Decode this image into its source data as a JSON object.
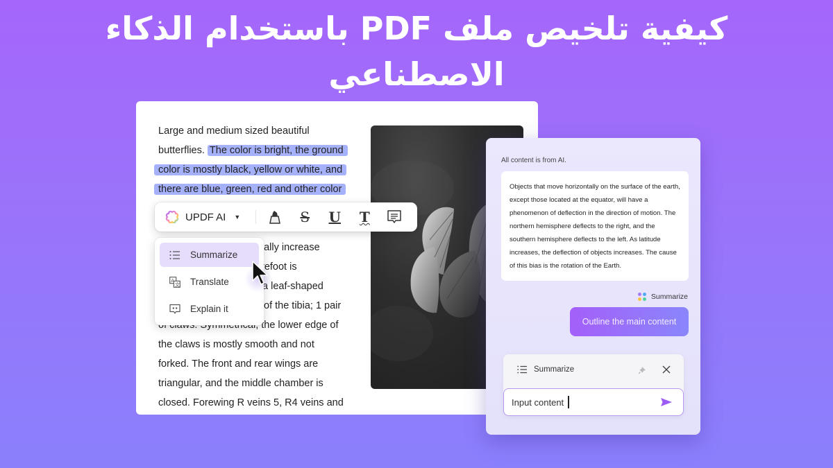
{
  "title": "كيفية تلخيص ملف PDF باستخدام الذكاء الاصطناعي",
  "document": {
    "lines": [
      {
        "plain": "Large and medium sized beautiful",
        "highlighted": ""
      },
      {
        "plain": "butterflies. ",
        "highlighted": "The color is bright, the ground"
      },
      {
        "plain": "",
        "highlighted": "color is mostly black, yellow or white, and"
      },
      {
        "plain": "",
        "highlighted": "there are blue, green, red and other color"
      },
      {
        "plain": "ually increase",
        "highlighted": ""
      },
      {
        "plain": "refoot is",
        "highlighted": ""
      },
      {
        "plain": "a leaf-shaped",
        "highlighted": ""
      },
      {
        "plain": "of the tibia; 1 pair",
        "highlighted": ""
      },
      {
        "plain": "of claws. Symmetrical, the lower edge of",
        "highlighted": ""
      },
      {
        "plain": "the claws is mostly smooth and not",
        "highlighted": ""
      },
      {
        "plain": "forked. The front and rear wings are",
        "highlighted": ""
      },
      {
        "plain": "triangular, and the middle chamber is",
        "highlighted": ""
      },
      {
        "plain": "closed. Forewing R veins 5, R4 veins and",
        "highlighted": ""
      }
    ],
    "highlight_color": "#a6b1fb",
    "image": "butterfly-photo"
  },
  "toolbar": {
    "ai_label": "UPDF AI",
    "tools": [
      "highlight-icon",
      "strikethrough-icon",
      "underline-icon",
      "squiggly-text-icon",
      "comment-icon"
    ]
  },
  "menu": {
    "items": [
      {
        "label": "Summarize",
        "icon": "list-icon",
        "active": true
      },
      {
        "label": "Translate",
        "icon": "translate-icon",
        "active": false
      },
      {
        "label": "Explain it",
        "icon": "explain-icon",
        "active": false
      }
    ]
  },
  "ai_panel": {
    "note": "All content is from AI.",
    "answer": "Objects that move horizontally on the surface of the earth, except those located at the equator, will have a phenomenon of deflection in the direction of motion. The northern hemisphere deflects to the right, and the southern hemisphere deflects to the left. As latitude increases, the deflection of objects increases. The cause of this bias is the rotation of the Earth.",
    "tag_label": "Summarize",
    "user_message": "Outline the main content",
    "composer": {
      "mode_label": "Summarize",
      "input_value": "Input content"
    },
    "accent_color": "#9b5cf6"
  }
}
